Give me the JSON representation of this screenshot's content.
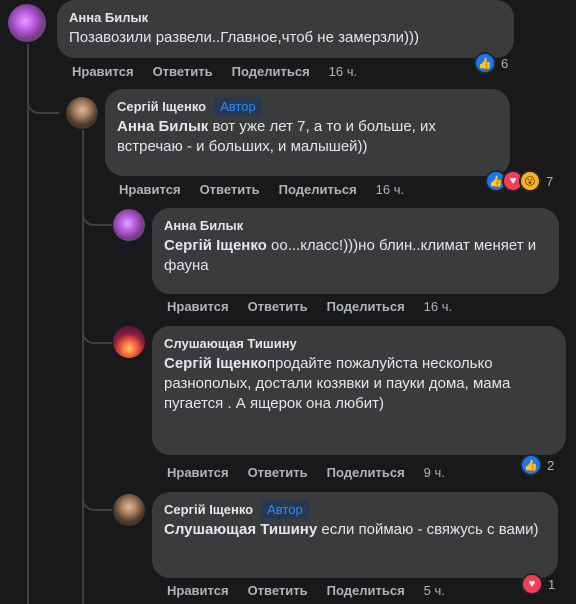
{
  "actions": {
    "like": "Нравится",
    "reply": "Ответить",
    "share": "Поделиться"
  },
  "comments": [
    {
      "author": "Анна Билык",
      "text": "Позавозили развели..Главное,чтоб не замерзли)))",
      "time": "16 ч.",
      "reactions_count": "6"
    },
    {
      "author": "Сергій Іщенко",
      "badge": "Автор",
      "mention": "Анна Билык",
      "text": " вот уже лет 7, а то и больше, их встречаю - и больших, и малышей))",
      "time": "16 ч.",
      "reactions_count": "7"
    },
    {
      "author": "Анна Билык",
      "mention": "Сергій Іщенко",
      "text": " оо...класс!)))но блин..климат меняет и фауна",
      "time": "16 ч."
    },
    {
      "author": "Слушающая Тишину",
      "mention": "Сергій Іщенко",
      "text": "продайте пожалуйста несколько разнополых, достали козявки и пауки дома, мама пугается . А ящерок она любит)",
      "time": "9 ч.",
      "reactions_count": "2"
    },
    {
      "author": "Сергій Іщенко",
      "badge": "Автор",
      "mention": "Слушающая Тишину",
      "text": " если поймаю - свяжусь с вами)",
      "time": "5 ч.",
      "reactions_count": "1"
    }
  ],
  "icons": {
    "like": "thumbs-up-icon",
    "love": "heart-icon",
    "wow": "wow-face-icon"
  },
  "colors": {
    "background": "#18191a",
    "bubble": "#3a3b3c",
    "accent": "#2d88ff",
    "muted": "#b0b3b8"
  }
}
